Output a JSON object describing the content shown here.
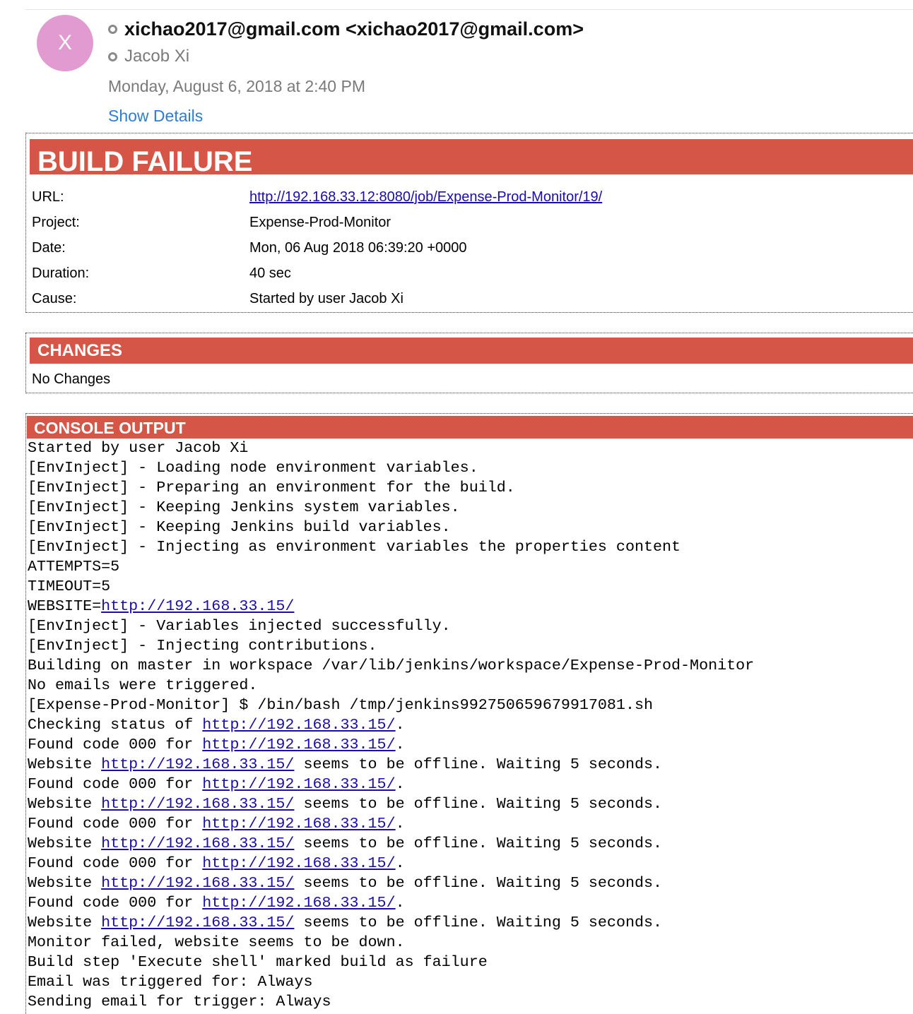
{
  "email": {
    "avatar_initial": "X",
    "from": "xichao2017@gmail.com <xichao2017@gmail.com>",
    "to": "Jacob Xi",
    "date": "Monday, August 6, 2018 at 2:40 PM",
    "show_details": "Show Details"
  },
  "build": {
    "title": "BUILD FAILURE",
    "rows": [
      {
        "label": "URL:",
        "value": "http://192.168.33.12:8080/job/Expense-Prod-Monitor/19/"
      },
      {
        "label": "Project:",
        "value": "Expense-Prod-Monitor"
      },
      {
        "label": "Date:",
        "value": "Mon, 06 Aug 2018 06:39:20 +0000"
      },
      {
        "label": "Duration:",
        "value": "40 sec"
      },
      {
        "label": "Cause:",
        "value": "Started by user Jacob Xi"
      }
    ]
  },
  "changes": {
    "title": "CHANGES",
    "text": "No Changes"
  },
  "console": {
    "title": "CONSOLE OUTPUT",
    "lines": [
      {
        "text": "Started by user Jacob Xi"
      },
      {
        "text": "[EnvInject] - Loading node environment variables."
      },
      {
        "text": "[EnvInject] - Preparing an environment for the build."
      },
      {
        "text": "[EnvInject] - Keeping Jenkins system variables."
      },
      {
        "text": "[EnvInject] - Keeping Jenkins build variables."
      },
      {
        "text": "[EnvInject] - Injecting as environment variables the properties content"
      },
      {
        "text": "ATTEMPTS=5"
      },
      {
        "text": "TIMEOUT=5"
      },
      {
        "pre": "WEBSITE=",
        "link": "http://192.168.33.15/",
        "post": ""
      },
      {
        "text": "[EnvInject] - Variables injected successfully."
      },
      {
        "text": "[EnvInject] - Injecting contributions."
      },
      {
        "text": "Building on master in workspace /var/lib/jenkins/workspace/Expense-Prod-Monitor"
      },
      {
        "text": "No emails were triggered."
      },
      {
        "text": "[Expense-Prod-Monitor] $ /bin/bash /tmp/jenkins992750659679917081.sh"
      },
      {
        "pre": "Checking status of ",
        "link": "http://192.168.33.15/",
        "post": "."
      },
      {
        "pre": "Found code 000 for ",
        "link": "http://192.168.33.15/",
        "post": "."
      },
      {
        "pre": "Website ",
        "link": "http://192.168.33.15/",
        "post": " seems to be offline. Waiting 5 seconds."
      },
      {
        "pre": "Found code 000 for ",
        "link": "http://192.168.33.15/",
        "post": "."
      },
      {
        "pre": "Website ",
        "link": "http://192.168.33.15/",
        "post": " seems to be offline. Waiting 5 seconds."
      },
      {
        "pre": "Found code 000 for ",
        "link": "http://192.168.33.15/",
        "post": "."
      },
      {
        "pre": "Website ",
        "link": "http://192.168.33.15/",
        "post": " seems to be offline. Waiting 5 seconds."
      },
      {
        "pre": "Found code 000 for ",
        "link": "http://192.168.33.15/",
        "post": "."
      },
      {
        "pre": "Website ",
        "link": "http://192.168.33.15/",
        "post": " seems to be offline. Waiting 5 seconds."
      },
      {
        "pre": "Found code 000 for ",
        "link": "http://192.168.33.15/",
        "post": "."
      },
      {
        "pre": "Website ",
        "link": "http://192.168.33.15/",
        "post": " seems to be offline. Waiting 5 seconds."
      },
      {
        "text": "Monitor failed, website seems to be down."
      },
      {
        "text": "Build step 'Execute shell' marked build as failure"
      },
      {
        "text": "Email was triggered for: Always"
      },
      {
        "text": "Sending email for trigger: Always"
      }
    ]
  },
  "colors": {
    "header_bar": "#d55646",
    "avatar": "#e19bd0",
    "link": "#1a0dab",
    "show_details": "#2f7cd0"
  }
}
